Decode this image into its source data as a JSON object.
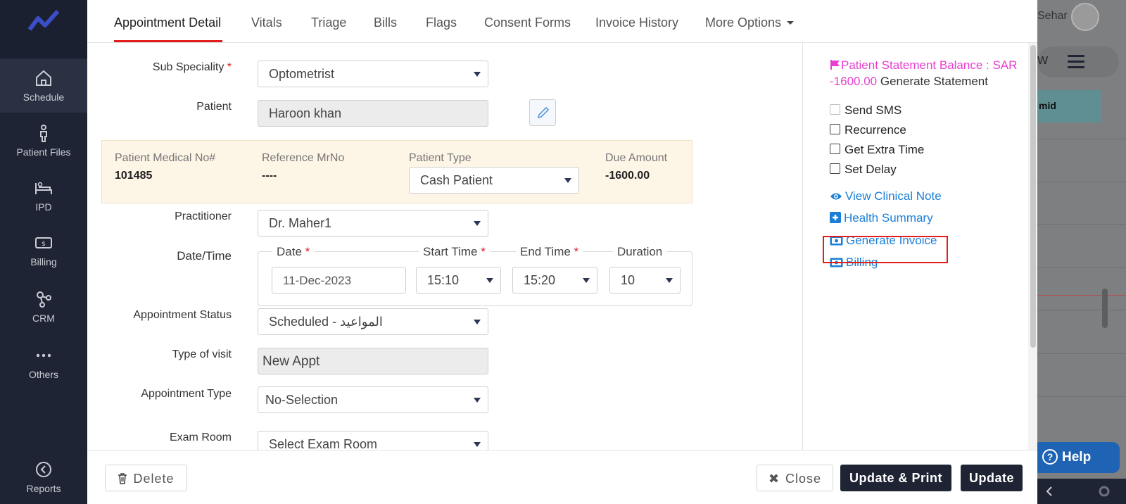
{
  "sidebar": {
    "items": [
      {
        "label": "Schedule",
        "icon": "home-icon",
        "active": true
      },
      {
        "label": "Patient Files",
        "icon": "person-icon"
      },
      {
        "label": "IPD",
        "icon": "bed-icon"
      },
      {
        "label": "Billing",
        "icon": "money-icon"
      },
      {
        "label": "CRM",
        "icon": "network-icon"
      },
      {
        "label": "Others",
        "icon": "more-icon"
      },
      {
        "label": "Reports",
        "icon": "report-icon"
      }
    ]
  },
  "background": {
    "user_name": "Sehar",
    "pill_text": "W",
    "teal_cell": "mid",
    "help_label": "Help"
  },
  "tabs": {
    "items": [
      "Appointment Detail",
      "Vitals",
      "Triage",
      "Bills",
      "Flags",
      "Consent Forms",
      "Invoice History",
      "More Options"
    ],
    "active": "Appointment Detail"
  },
  "form": {
    "sub_speciality": {
      "label": "Sub Speciality",
      "required": "*",
      "value": "Optometrist"
    },
    "patient": {
      "label": "Patient",
      "value": "Haroon khan"
    },
    "info": {
      "medical_no_label": "Patient Medical No#",
      "medical_no": "101485",
      "reference_label": "Reference MrNo",
      "reference": "----",
      "patient_type_label": "Patient Type",
      "patient_type": "Cash Patient",
      "due_label": "Due Amount",
      "due": "-1600.00"
    },
    "practitioner": {
      "label": "Practitioner",
      "value": "Dr. Maher1"
    },
    "datetime": {
      "label": "Date/Time",
      "date_label": "Date",
      "date": "11-Dec-2023",
      "start_label": "Start Time",
      "start": "15:10",
      "end_label": "End Time",
      "end": "15:20",
      "duration_label": "Duration",
      "duration": "10",
      "required": "*"
    },
    "status": {
      "label": "Appointment Status",
      "value": "Scheduled - المواعيد"
    },
    "visit": {
      "label": "Type of visit",
      "value": "New Appt"
    },
    "appt_type": {
      "label": "Appointment Type",
      "value": "No-Selection"
    },
    "exam_room": {
      "label": "Exam Room",
      "value": "Select Exam Room"
    }
  },
  "right": {
    "balance_line1": "Patient Statement Balance : SAR",
    "balance_amount": "-1600.00",
    "generate_statement": "Generate Statement",
    "checks": [
      "Send SMS",
      "Recurrence",
      "Get Extra Time",
      "Set Delay"
    ],
    "links": {
      "view_clinical_note": "View Clinical Note",
      "health_summary": "Health Summary",
      "generate_invoice": "Generate Invoice",
      "billing": "Billing"
    }
  },
  "footer": {
    "delete": "Delete",
    "close": "Close",
    "update_print": "Update & Print",
    "update": "Update"
  },
  "colors": {
    "sidebar": "#1e2433",
    "accent_red": "#e31c1c",
    "link_blue": "#1a7fd6",
    "magenta": "#e83fd0",
    "info_band": "#fdf5e6"
  }
}
